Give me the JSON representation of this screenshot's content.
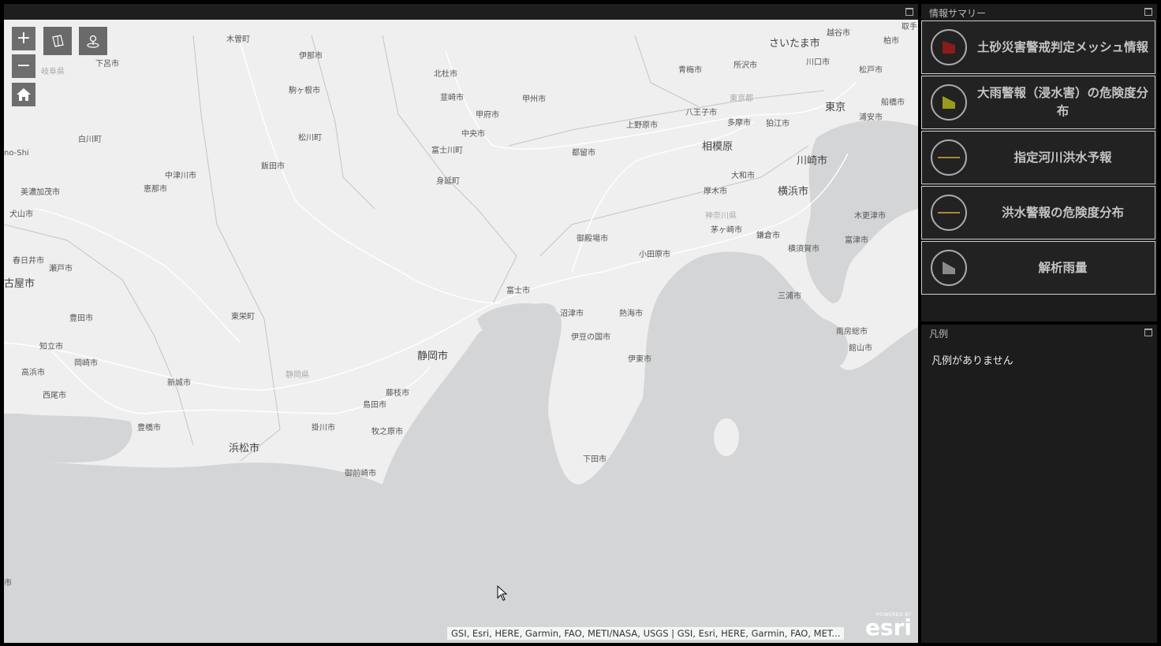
{
  "map": {
    "zoom_in": "+",
    "zoom_out": "−",
    "attribution": "GSI, Esri, HERE, Garmin, FAO, METI/NASA, USGS | GSI, Esri, HERE, Garmin, FAO, MET...",
    "esri_powered": "POWERED BY",
    "esri_logo": "esri",
    "labels": {
      "kisomachi": "木曽町",
      "inashi": "伊那市",
      "gerou": "下呂市",
      "gifu": "岐阜県",
      "komagane": "駒ヶ根市",
      "hokuto": "北杜市",
      "nirasaki": "韮崎市",
      "kofu": "甲府市",
      "koshu": "甲州市",
      "chuo": "中央市",
      "ome": "青梅市",
      "tokorozawa": "所沢市",
      "saitama": "さいたま市",
      "koshigaya": "越谷市",
      "kashiwa": "柏市",
      "kawaguchi": "川口市",
      "matsudo": "松戸市",
      "tokyo_pref": "東京都",
      "tokyo": "東京",
      "funabashi": "船橋市",
      "hachioji": "八王子市",
      "tama": "多摩市",
      "komae": "狛江市",
      "uenohara": "上野原市",
      "urayasu": "浦安市",
      "shirakawa": "白川町",
      "matsukawa": "松川町",
      "fujikawaguchiko": "富士川町",
      "tsuru": "都留市",
      "sagamihara": "相模原",
      "kawasaki": "川崎市",
      "no_shi": "no-Shi",
      "iida": "飯田市",
      "nakatsugawa": "中津川市",
      "ena": "恵那市",
      "minokamo": "美濃加茂市",
      "minobu": "身延町",
      "yamato": "大和市",
      "atsugi": "厚木市",
      "yokohama": "横浜市",
      "inuyama": "犬山市",
      "kanagawa": "神奈川県",
      "kisarazu": "木更津市",
      "chigasaki": "茅ヶ崎市",
      "kamakura": "鎌倉市",
      "futtsu": "富津市",
      "gotemba": "御殿場市",
      "kasugai": "春日井市",
      "odawara": "小田原市",
      "yokosuka": "横須賀市",
      "seto": "瀬戸市",
      "nagoya": "古屋市",
      "fuji": "富士市",
      "miura": "三浦市",
      "toyota": "豊田市",
      "toei": "東栄町",
      "numazu": "沼津市",
      "atami": "熱海市",
      "minamiboso": "南房総市",
      "chiryu": "知立市",
      "izunokuni": "伊豆の国市",
      "tateyama": "館山市",
      "shizuoka": "静岡市",
      "ito": "伊東市",
      "okazaki": "岡崎市",
      "takahama": "高浜市",
      "shizuoka_pref": "静岡県",
      "shinshiro": "新城市",
      "fujieda": "藤枝市",
      "nishio": "西尾市",
      "shimada": "島田市",
      "toyohashi": "豊橋市",
      "kakegawa": "掛川市",
      "makinohara": "牧之原市",
      "hamamatsu": "浜松市",
      "shimoda": "下田市",
      "omaezaki": "御前崎市",
      "toride": "取手",
      "ichi": "市"
    }
  },
  "summary": {
    "title": "情報サマリー",
    "items": [
      {
        "label": "土砂災害警戒判定メッシュ情報",
        "icon": "red-flag-icon",
        "color": "#8b1a1a"
      },
      {
        "label": "大雨警報（浸水害）の危険度分布",
        "icon": "yellow-flag-icon",
        "color": "#9a9a1e"
      },
      {
        "label": "指定河川洪水予報",
        "icon": "line-icon",
        "color": "#a8893a"
      },
      {
        "label": "洪水警報の危険度分布",
        "icon": "line-icon",
        "color": "#a8893a"
      },
      {
        "label": "解析雨量",
        "icon": "gray-flag-icon",
        "color": "#8a8a8a"
      }
    ]
  },
  "legend": {
    "title": "凡例",
    "empty": "凡例がありません"
  }
}
